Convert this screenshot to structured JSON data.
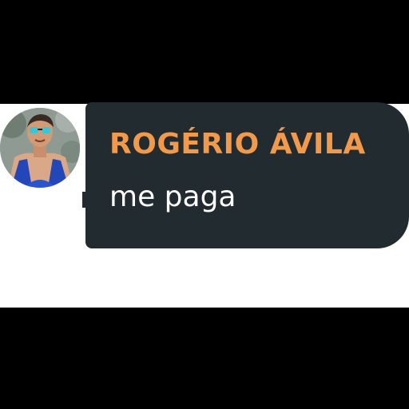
{
  "message": {
    "sender_name": "ROGÉRIO ÁVILA",
    "text": "me paga",
    "sender_name_color": "#f2994a",
    "bubble_color": "#222b30",
    "text_color": "#ffffff"
  },
  "avatar": {
    "icon": "avatar-photo"
  }
}
